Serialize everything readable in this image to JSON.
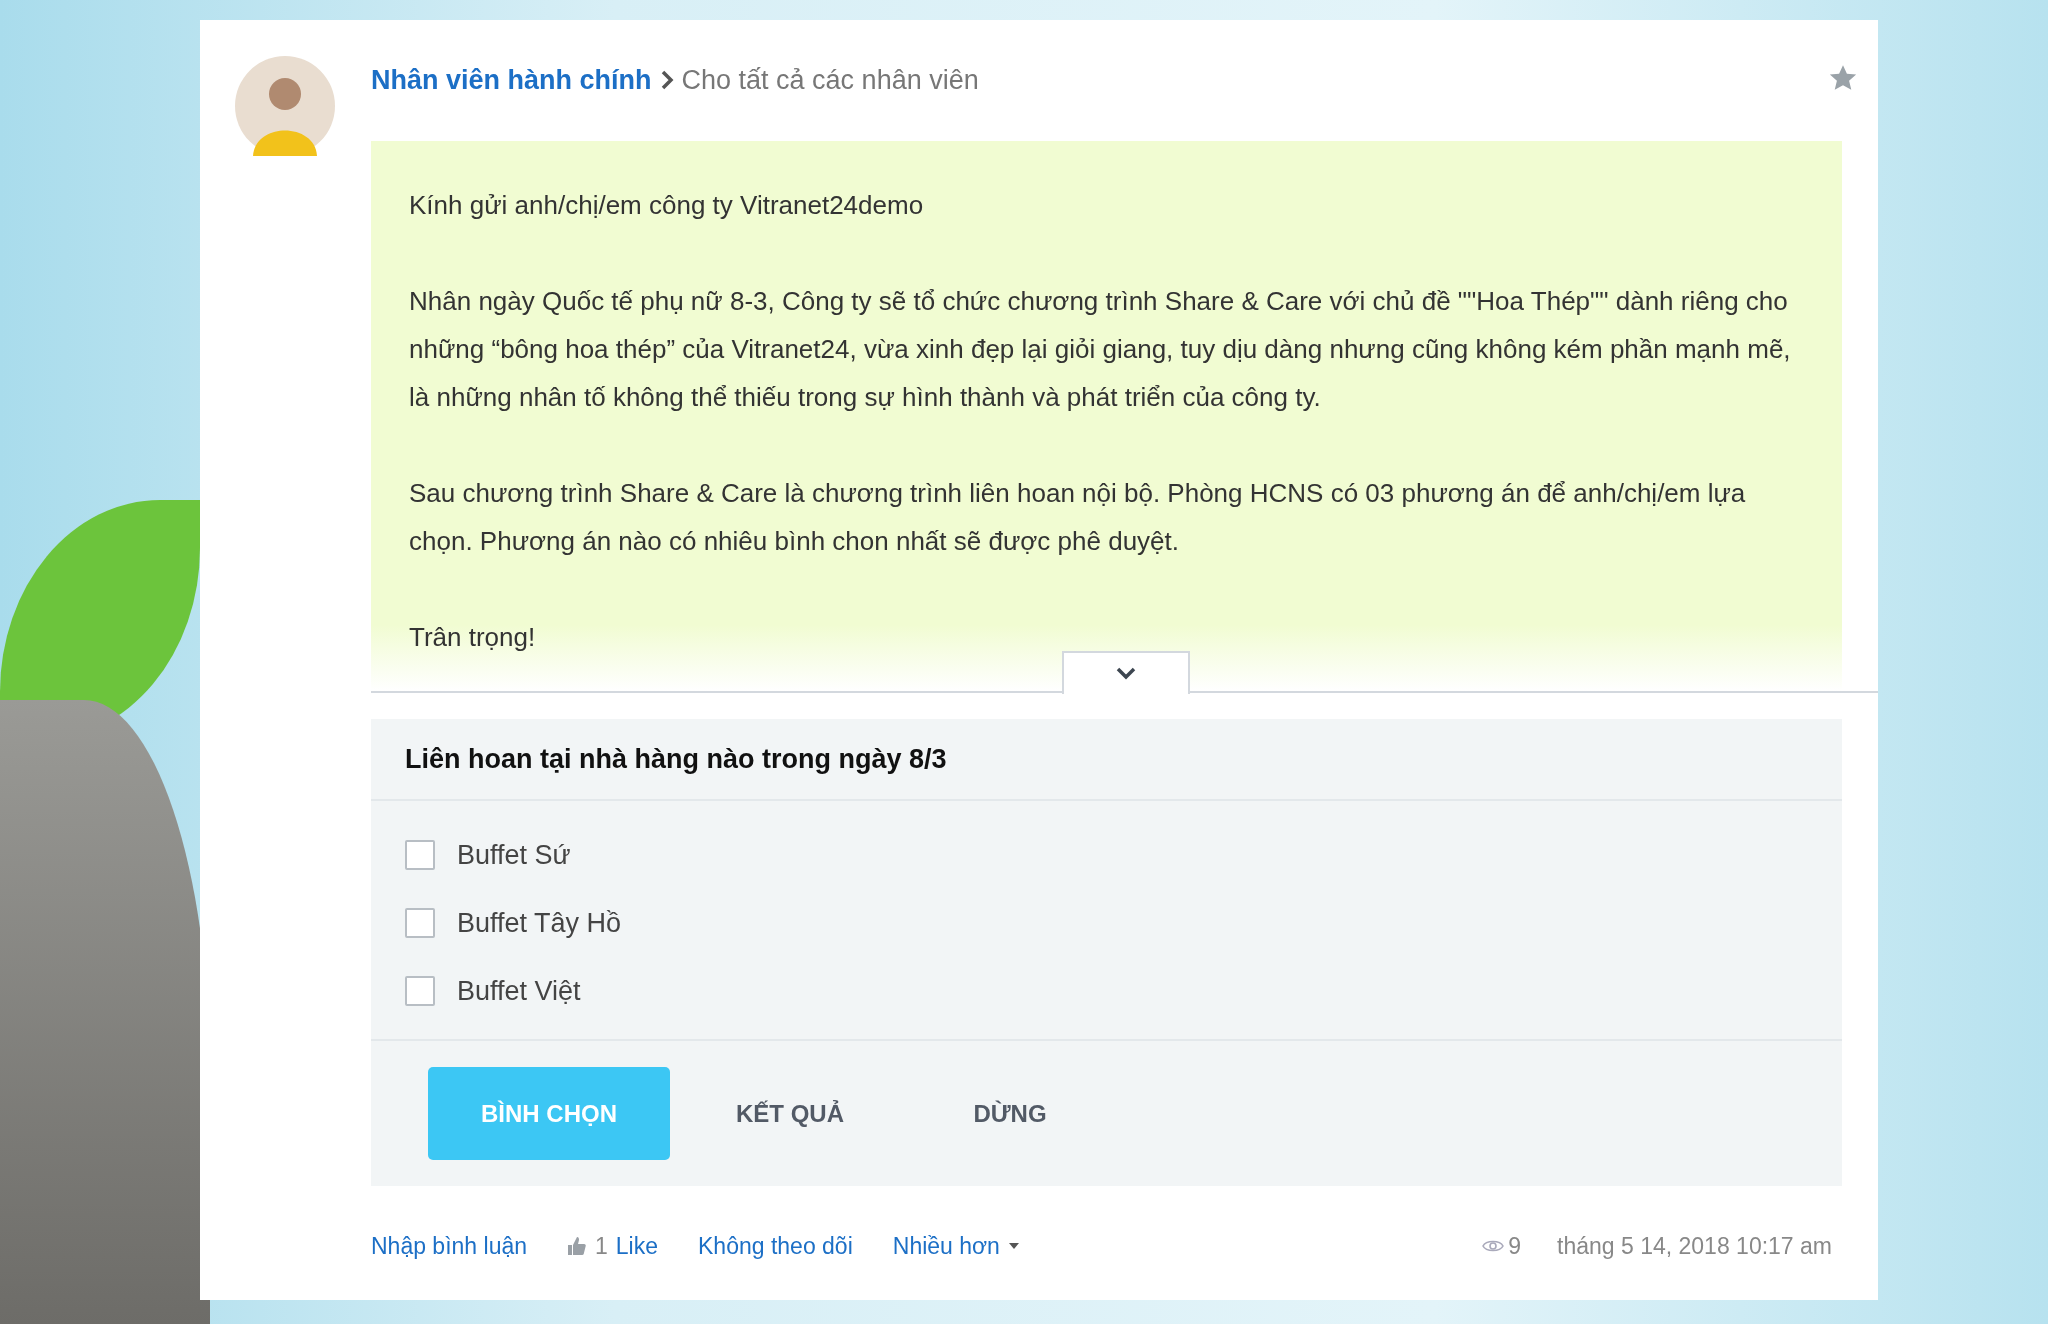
{
  "post": {
    "author": "Nhân viên hành chính",
    "audience": "Cho tất cả các nhân viên"
  },
  "message": {
    "paragraphs": [
      "Kính gửi anh/chị/em công ty Vitranet24demo",
      "Nhân ngày Quốc tế phụ nữ 8-3, Công ty sẽ tổ chức chương trình Share & Care với chủ đề \"\"Hoa Thép\"\" dành riêng cho những “bông hoa thép” của Vitranet24, vừa xinh đẹp lại giỏi giang, tuy dịu dàng nhưng cũng không kém phần mạnh mẽ, là những nhân tố không thể thiếu trong sự hình thành và phát triển của công ty.",
      "Sau chương trình Share & Care là chương trình liên hoan nội bộ. Phòng HCNS có 03 phương án để anh/chị/em lựa chọn. Phương án nào có nhiêu bình chon nhất sẽ được phê duyệt.",
      "Trân trọng!"
    ],
    "expanded": false
  },
  "poll": {
    "question": "Liên hoan tại nhà hàng nào trong ngày 8/3",
    "options": [
      {
        "label": "Buffet Sứ",
        "checked": false
      },
      {
        "label": "Buffet Tây Hồ",
        "checked": false
      },
      {
        "label": "Buffet Việt",
        "checked": false
      }
    ],
    "buttons": [
      {
        "label": "BÌNH CHỌN",
        "primary": true
      },
      {
        "label": "KẾT QUẢ",
        "primary": false
      },
      {
        "label": "DỪNG",
        "primary": false
      }
    ]
  },
  "footer": {
    "comment": "Nhập bình luận",
    "like_count": "1",
    "like": "Like",
    "unfollow": "Không theo dõi",
    "more": "Nhiều hơn",
    "views": "9",
    "timestamp": "tháng 5 14, 2018 10:17 am"
  }
}
